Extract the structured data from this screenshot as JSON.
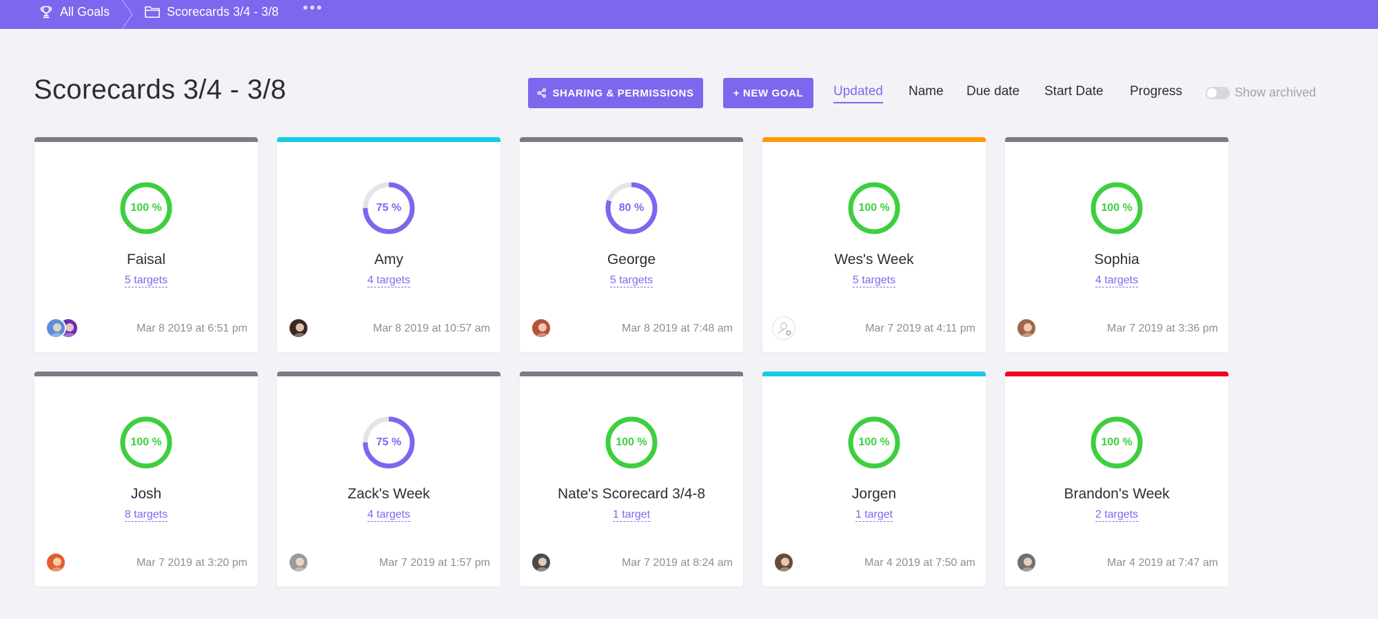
{
  "breadcrumb": {
    "root_label": "All Goals",
    "folder_label": "Scorecards 3/4 - 3/8"
  },
  "header": {
    "title": "Scorecards 3/4 - 3/8",
    "share_button": "SHARING & PERMISSIONS",
    "new_goal_button": "+ NEW GOAL",
    "sort_options": [
      "Updated",
      "Name",
      "Due date",
      "Start Date",
      "Progress"
    ],
    "active_sort": "Updated",
    "show_archived_label": "Show archived",
    "show_archived_on": false
  },
  "colors": {
    "brand": "#7b68ee",
    "complete": "#3ecf3e",
    "ring_track": "#e4e4e8",
    "bar_gray": "#7c7b85",
    "bar_cyan": "#13cde3",
    "bar_orange": "#ff9800",
    "bar_red": "#f0061e"
  },
  "goals": [
    {
      "name": "Faisal",
      "progress": 100,
      "progress_label": "100 %",
      "targets": "5 targets",
      "updated": "Mar 8 2019 at 6:51 pm",
      "bar_color": "#7c7b85",
      "avatar_colors": [
        "#5b8fd6",
        "#6a2fb3"
      ]
    },
    {
      "name": "Amy",
      "progress": 75,
      "progress_label": "75 %",
      "targets": "4 targets",
      "updated": "Mar 8 2019 at 10:57 am",
      "bar_color": "#13cde3",
      "avatar_colors": [
        "#3a2a22"
      ]
    },
    {
      "name": "George",
      "progress": 80,
      "progress_label": "80 %",
      "targets": "5 targets",
      "updated": "Mar 8 2019 at 7:48 am",
      "bar_color": "#7c7b85",
      "avatar_colors": [
        "#b5523a"
      ]
    },
    {
      "name": "Wes's Week",
      "progress": 100,
      "progress_label": "100 %",
      "targets": "5 targets",
      "updated": "Mar 7 2019 at 4:11 pm",
      "bar_color": "#ff9800",
      "avatar_colors": []
    },
    {
      "name": "Sophia",
      "progress": 100,
      "progress_label": "100 %",
      "targets": "4 targets",
      "updated": "Mar 7 2019 at 3:36 pm",
      "bar_color": "#7c7b85",
      "avatar_colors": [
        "#a0674a"
      ]
    },
    {
      "name": "Josh",
      "progress": 100,
      "progress_label": "100 %",
      "targets": "8 targets",
      "updated": "Mar 7 2019 at 3:20 pm",
      "bar_color": "#7c7b85",
      "avatar_colors": [
        "#e0602a"
      ]
    },
    {
      "name": "Zack's Week",
      "progress": 75,
      "progress_label": "75 %",
      "targets": "4 targets",
      "updated": "Mar 7 2019 at 1:57 pm",
      "bar_color": "#7c7b85",
      "avatar_colors": [
        "#9a9a9a"
      ]
    },
    {
      "name": "Nate's Scorecard 3/4-8",
      "progress": 100,
      "progress_label": "100 %",
      "targets": "1 target",
      "updated": "Mar 7 2019 at 8:24 am",
      "bar_color": "#7c7b85",
      "avatar_colors": [
        "#4a4a4a"
      ]
    },
    {
      "name": "Jorgen",
      "progress": 100,
      "progress_label": "100 %",
      "targets": "1 target",
      "updated": "Mar 4 2019 at 7:50 am",
      "bar_color": "#13cde3",
      "avatar_colors": [
        "#6b4a3a"
      ]
    },
    {
      "name": "Brandon's Week",
      "progress": 100,
      "progress_label": "100 %",
      "targets": "2 targets",
      "updated": "Mar 4 2019 at 7:47 am",
      "bar_color": "#f0061e",
      "avatar_colors": [
        "#707070"
      ]
    }
  ]
}
